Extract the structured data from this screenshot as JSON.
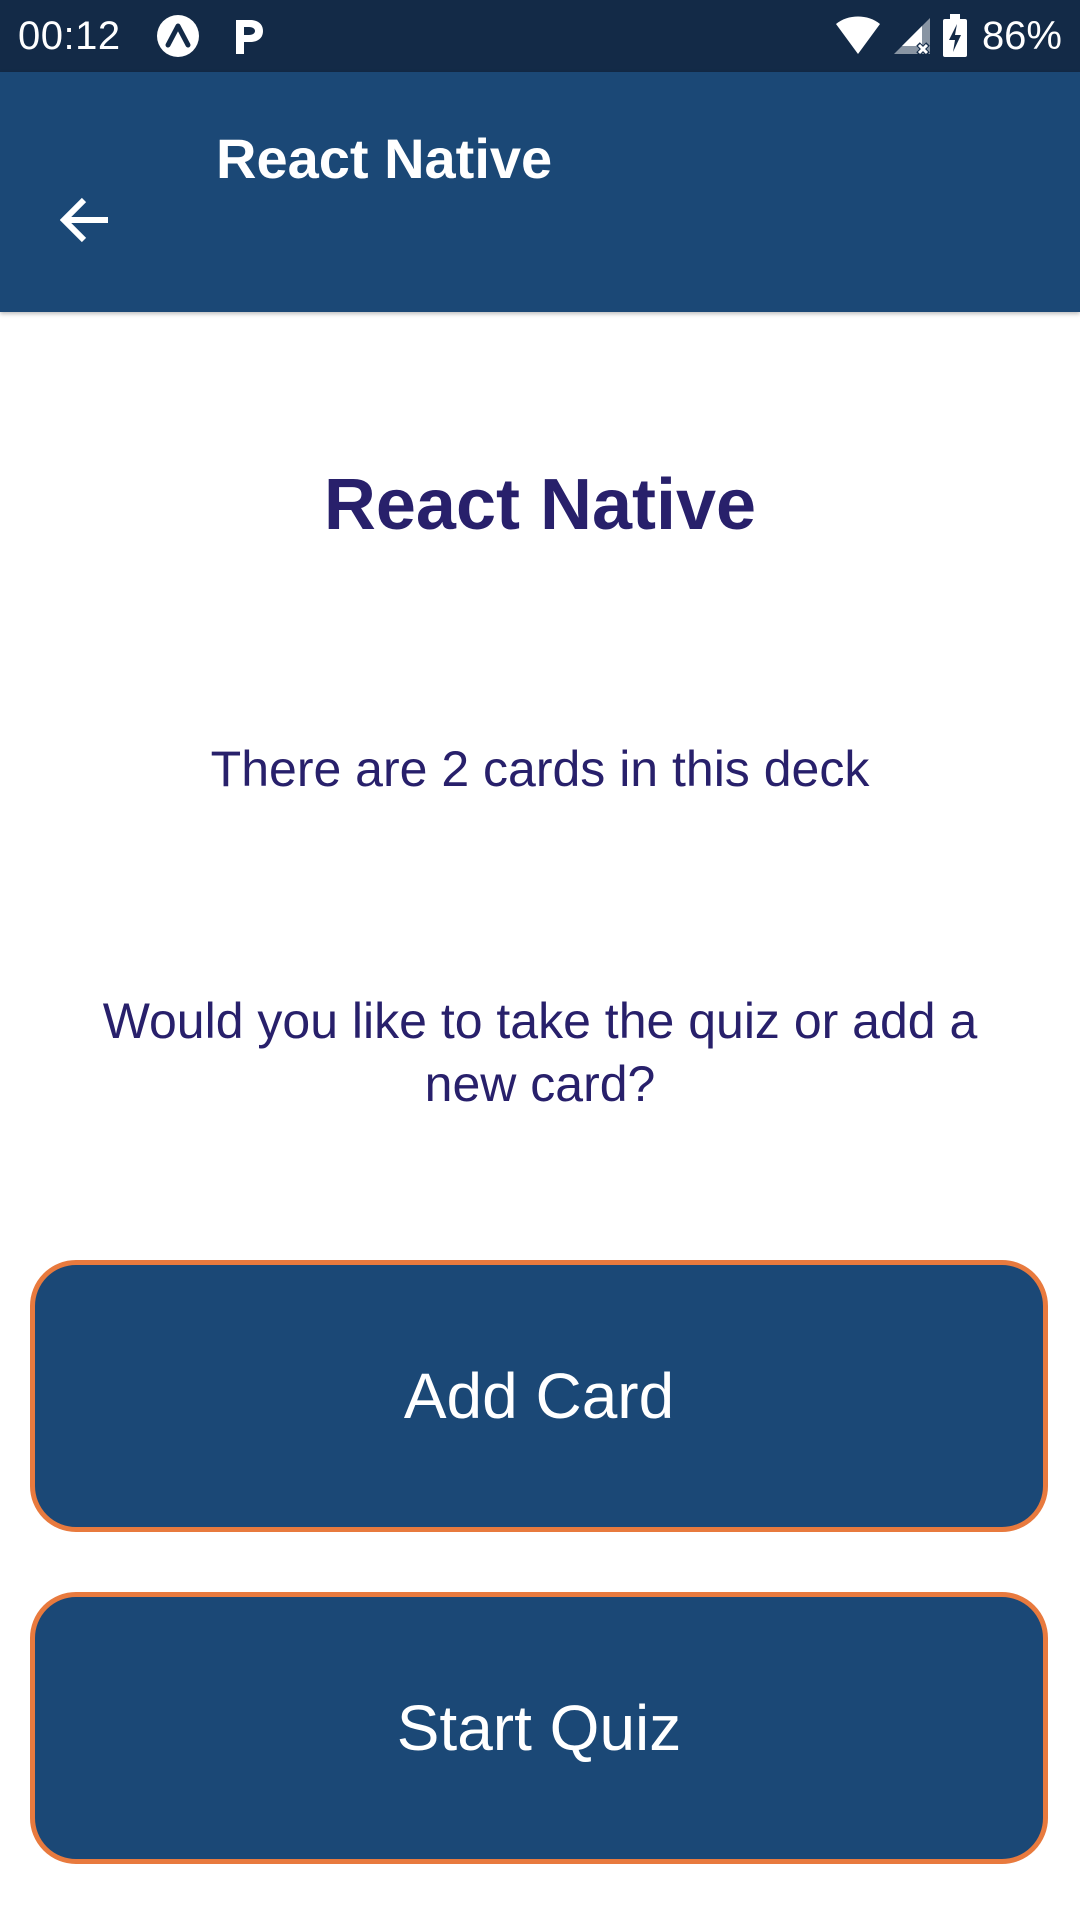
{
  "status_bar": {
    "time": "00:12",
    "icons": [
      "expo-icon",
      "p-icon",
      "wifi-icon",
      "signal-icon",
      "battery-icon"
    ],
    "battery": "86%"
  },
  "app_bar": {
    "title": "React Native",
    "back_icon": "arrow-left-icon"
  },
  "deck": {
    "title": "React Native",
    "card_count_text": "There are 2 cards in this deck",
    "prompt": "Would you like to take the quiz or add a new card?"
  },
  "actions": {
    "add_card_label": "Add Card",
    "start_quiz_label": "Start Quiz"
  },
  "colors": {
    "status_bar": "#132a47",
    "app_bar": "#1b4876",
    "text_primary": "#28206b",
    "button_bg": "#1b4876",
    "button_border": "#e87a3e"
  }
}
